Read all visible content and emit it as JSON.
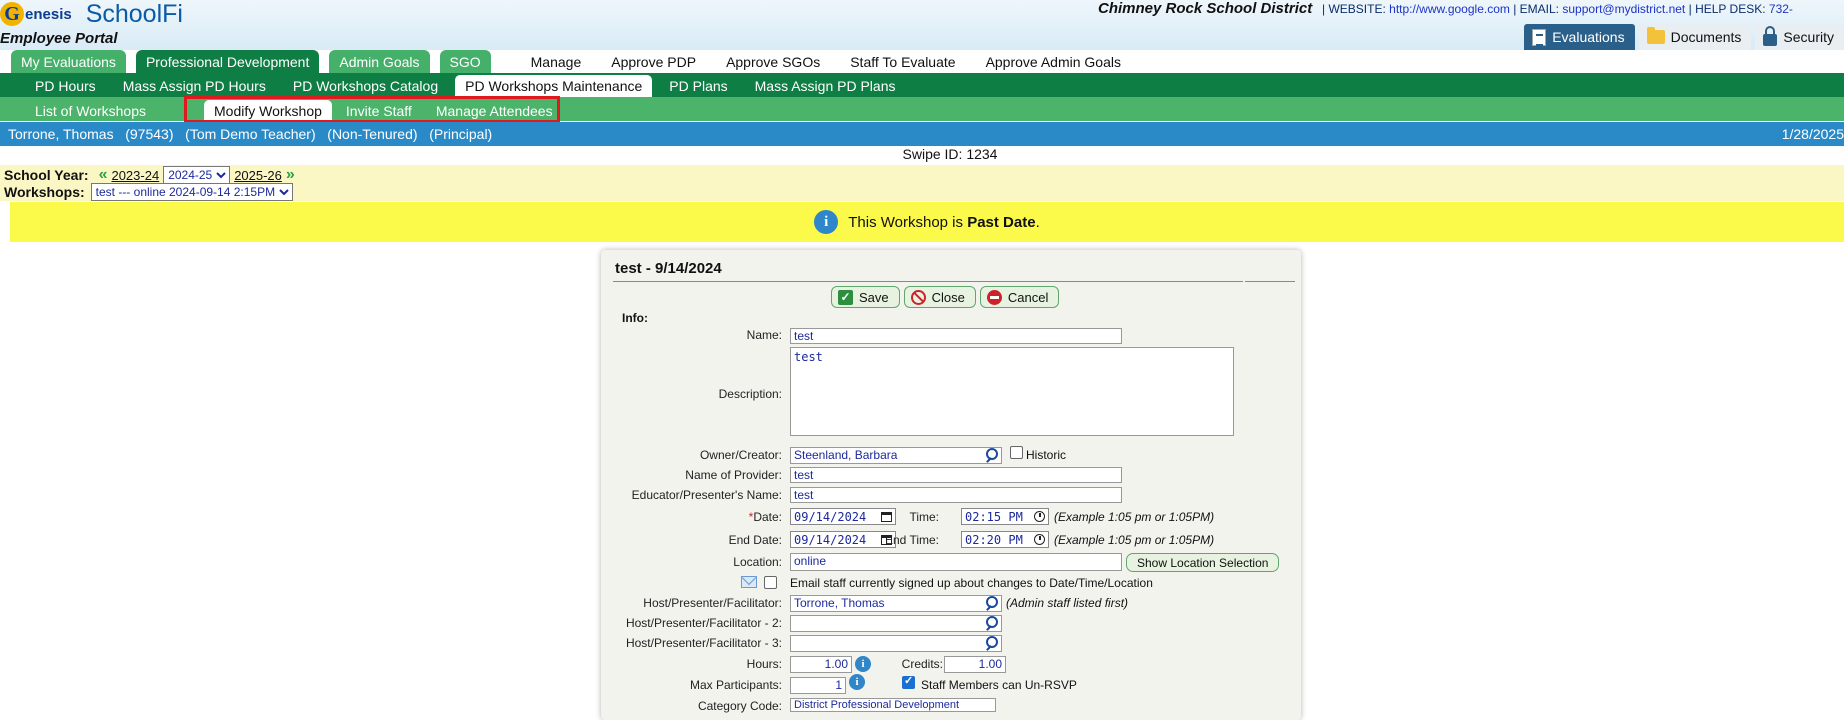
{
  "header": {
    "logo_g": "G",
    "logo_genesis": "enesis",
    "logo_product": "SchoolFi",
    "portal": "Employee Portal",
    "district": "Chimney Rock School District",
    "website_label": "WEBSITE:",
    "website": "http://www.google.com",
    "email_label": "EMAIL:",
    "email": "support@mydistrict.net",
    "helpdesk_label": "HELP DESK:",
    "helpdesk": "732-",
    "top_buttons": [
      "Evaluations",
      "Documents",
      "Security"
    ]
  },
  "nav1": {
    "tabs": [
      "My Evaluations",
      "Professional Development",
      "Admin Goals",
      "SGO"
    ],
    "active": "Professional Development",
    "menu": [
      "Manage",
      "Approve PDP",
      "Approve SGOs",
      "Staff To Evaluate",
      "Approve Admin Goals"
    ]
  },
  "nav2": {
    "tabs": [
      "PD Hours",
      "Mass Assign PD Hours",
      "PD Workshops Catalog",
      "PD Workshops Maintenance",
      "PD Plans",
      "Mass Assign PD Plans"
    ],
    "active": "PD Workshops Maintenance"
  },
  "nav3": {
    "tabs": [
      "List of Workshops",
      "Modify Workshop",
      "Invite Staff",
      "Manage Attendees"
    ],
    "active": "Modify Workshop"
  },
  "infobar": {
    "who": "Torrone, Thomas   (97543)   (Tom Demo Teacher)   (Non-Tenured)   (Principal)",
    "date": "1/28/2025"
  },
  "swipe": "Swipe ID: 1234",
  "filter": {
    "school_year_label": "School Year:",
    "prev_year": "2023-24",
    "current_year": "2024-25",
    "next_year": "2025-26",
    "workshops_label": "Workshops:",
    "workshop_selected": "test --- online 2024-09-14 2:15PM"
  },
  "alert": {
    "text": "This Workshop is ",
    "bold": "Past Date",
    "end": "."
  },
  "form": {
    "title": "test - 9/14/2024",
    "save": "Save",
    "close": "Close",
    "cancel": "Cancel",
    "info_label": "Info:",
    "name_label": "Name:",
    "name": "test",
    "description_label": "Description:",
    "description": "test",
    "owner_label": "Owner/Creator:",
    "owner": "Steenland, Barbara",
    "historic_label": "Historic",
    "provider_label": "Name of Provider:",
    "provider": "test",
    "presenter_name_label": "Educator/Presenter's Name:",
    "presenter_name": "test",
    "date_req": "*",
    "date_label": "Date:",
    "date": "09/14/2024",
    "time_label": "Time:",
    "time": "02:15 PM",
    "time_example": "(Example 1:05 pm or 1:05PM)",
    "end_date_label": "End Date:",
    "end_date": "09/14/2024",
    "end_time_label": "End Time:",
    "end_time": "02:20 PM",
    "end_time_example": "(Example 1:05 pm or 1:05PM)",
    "location_label": "Location:",
    "location": "online",
    "show_location": "Show Location Selection",
    "email_staff": "Email staff currently signed up about changes to Date/Time/Location",
    "host_label": "Host/Presenter/Facilitator:",
    "host": "Torrone, Thomas",
    "host_note": "(Admin staff listed first)",
    "host2_label": "Host/Presenter/Facilitator - 2:",
    "host2": "",
    "host3_label": "Host/Presenter/Facilitator - 3:",
    "host3": "",
    "hours_label": "Hours:",
    "hours": "1.00",
    "credits_label": "Credits:",
    "credits": "1.00",
    "max_label": "Max Participants:",
    "max": "1",
    "unrsvp_label": "Staff Members can Un-RSVP",
    "category_label": "Category Code:",
    "category": "District Professional Development"
  },
  "colors": {
    "green_dark": "#0f7e44",
    "green_light": "#4cb36b",
    "blue_bar": "#2a8ac7",
    "alert_yellow": "#fbfa4a",
    "highlight_red": "#e0191e"
  }
}
